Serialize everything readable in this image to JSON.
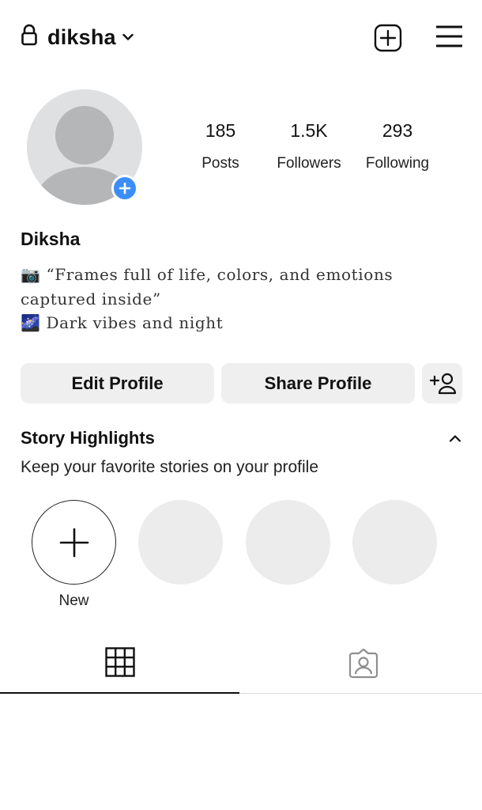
{
  "header": {
    "username": "diksha",
    "icons": [
      "lock-icon",
      "chevron-down-icon",
      "create-post-icon",
      "hamburger-menu-icon"
    ]
  },
  "profile": {
    "avatar_icon": "default-avatar",
    "add_story_icon": "plus-badge-icon",
    "stats": [
      {
        "value": "185",
        "label": "Posts"
      },
      {
        "value": "1.5K",
        "label": "Followers"
      },
      {
        "value": "293",
        "label": "Following"
      }
    ],
    "display_name": "Diksha",
    "bio_line1": "📷 “Frames full of life, colors, and emotions",
    "bio_line2": "captured inside”",
    "bio_line3": "🌌 Dark vibes and night"
  },
  "actions": {
    "edit_label": "Edit Profile",
    "share_label": "Share Profile",
    "add_user_icon": "add-person-icon"
  },
  "highlights": {
    "title": "Story Highlights",
    "subtitle": "Keep your favorite stories on your profile",
    "new_label": "New"
  },
  "tabs": {
    "items": [
      "grid-icon",
      "tagged-icon"
    ],
    "active": "grid"
  },
  "colors": {
    "accent_blue": "#3b8ef5",
    "button_bg": "#efefef",
    "placeholder_gray": "#ececec"
  }
}
